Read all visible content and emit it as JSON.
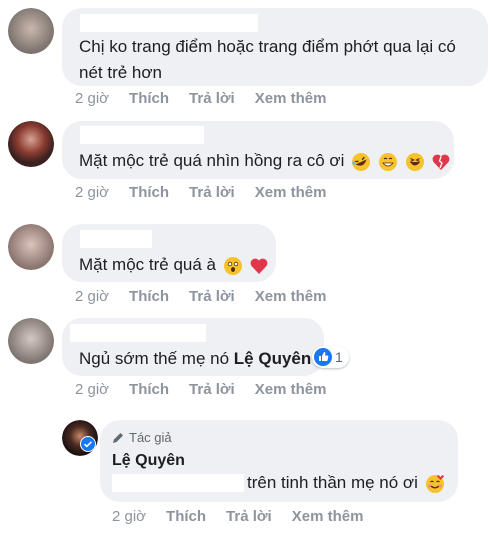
{
  "comments": [
    {
      "text": "Chị ko trang điểm hoặc trang điểm phớt qua lại có nét trẻ hơn",
      "time": "2 giờ",
      "like": "Thích",
      "reply": "Trả lời",
      "more": "Xem thêm"
    },
    {
      "text": "Mặt mộc trẻ quá nhìn hồng ra cô ơi",
      "emojis": [
        "rolling-laugh-emoji",
        "grin-emoji",
        "laughing-emoji",
        "broken-heart-emoji"
      ],
      "time": "2 giờ",
      "like": "Thích",
      "reply": "Trả lời",
      "more": "Xem thêm"
    },
    {
      "text": "Mặt mộc trẻ quá à",
      "emojis": [
        "astonished-emoji",
        "red-heart-emoji"
      ],
      "time": "2 giờ",
      "like": "Thích",
      "reply": "Trả lời",
      "more": "Xem thêm"
    },
    {
      "text_prefix": "Ngủ sớm thế mẹ nó",
      "mention": "Lệ Quyên",
      "reaction_count": "1",
      "time": "2 giờ",
      "like": "Thích",
      "reply": "Trả lời",
      "more": "Xem thêm"
    }
  ],
  "reply": {
    "badge": "Tác giả",
    "author": "Lệ Quyên",
    "text": "trên tinh thần mẹ nó ơi",
    "time": "2 giờ",
    "like": "Thích",
    "reply": "Trả lời",
    "more": "Xem thêm"
  },
  "colors": {
    "bubble": "#eef0f3",
    "meta": "#8d949e",
    "like_blue": "#1877f2",
    "verified": "#1877f2"
  }
}
